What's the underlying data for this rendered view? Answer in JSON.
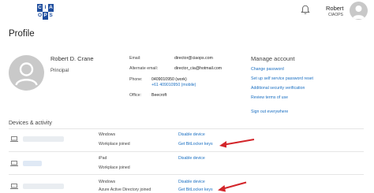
{
  "header": {
    "logo_letters": [
      "C",
      "I",
      "A",
      "O",
      "P",
      "S"
    ],
    "user_name": "Robert",
    "user_tenant": "CIAOPS",
    "icons": {
      "notifications": "bell-icon"
    }
  },
  "page": {
    "title": "Profile"
  },
  "profile": {
    "name": "Robert D. Crane",
    "role": "Principal",
    "fields": {
      "email_label": "Email:",
      "email_value": "director@ciaops.com",
      "alt_email_label": "Alternate email:",
      "alt_email_value": "director_cia@hotmail.com",
      "phone_label": "Phone:",
      "phone_value_1": "0409010950 (work)",
      "phone_value_2": "+61 409010950 (mobile)",
      "office_label": "Office:",
      "office_value": "Beecroft"
    }
  },
  "manage": {
    "title": "Manage account",
    "links": [
      "Change password",
      "Set up self service password reset",
      "Additional security verification",
      "Review terms of use"
    ],
    "sign_out": "Sign out everywhere"
  },
  "devices": {
    "title": "Devices & activity",
    "items": [
      {
        "os": "Windows",
        "join_type": "Workplace joined",
        "disable": "Disable device",
        "bitlocker": "Get BitLocker keys"
      },
      {
        "os": "iPad",
        "join_type": "Workplace joined",
        "disable": "Disable device",
        "bitlocker": ""
      },
      {
        "os": "Windows",
        "join_type": "Azure Active Directory joined",
        "disable": "Disable device",
        "bitlocker": "Get BitLocker keys"
      }
    ]
  },
  "colors": {
    "link": "#1a6fc2",
    "annotation_arrow": "#d3252a",
    "logo_blue": "#1f4e9e"
  }
}
